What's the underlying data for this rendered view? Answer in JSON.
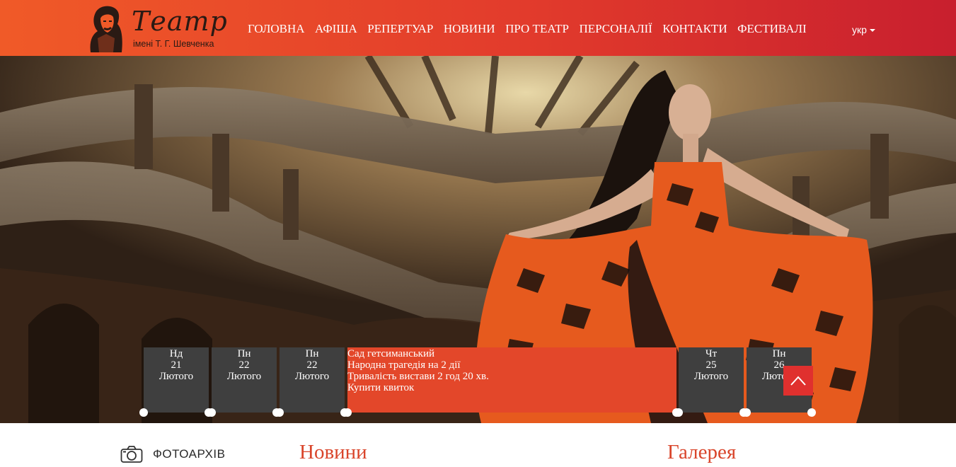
{
  "header": {
    "logo_title": "Театр",
    "logo_subtitle": "імені Т. Г. Шевченка",
    "nav": [
      "ГОЛОВНА",
      "АФІША",
      "РЕПЕРТУАР",
      "НОВИНИ",
      "ПРО ТЕАТР",
      "ПЕРСОНАЛІЇ",
      "КОНТАКТИ",
      "ФЕСТИВАЛІ"
    ],
    "language": "укр"
  },
  "schedule": {
    "days": [
      {
        "weekday": "Нд",
        "day": "21",
        "month": "Лютого"
      },
      {
        "weekday": "Пн",
        "day": "22",
        "month": "Лютого"
      },
      {
        "weekday": "Пн",
        "day": "22",
        "month": "Лютого"
      },
      {
        "weekday": "Чт",
        "day": "25",
        "month": "Лютого"
      },
      {
        "weekday": "Пн",
        "day": "26",
        "month": "Лютого"
      }
    ],
    "event": {
      "title": "Сад гетсиманський",
      "genre": "Народна трагедія на 2 дії",
      "duration": "Тривалість вистави 2 год 20 хв.",
      "buy": "Купити квиток"
    }
  },
  "sections": {
    "photo_archive": "ФОТОАРХІВ",
    "news": "Новини",
    "gallery": "Галерея"
  },
  "icons": {
    "scroll_top": "chevron-up-icon",
    "camera": "camera-icon",
    "lang_caret": "caret-down-icon"
  },
  "colors": {
    "header_start": "#f05a28",
    "header_end": "#c81f2e",
    "event_bg": "#e3472a",
    "day_bg": "#3f3f3f",
    "section_title": "#d9452b"
  }
}
